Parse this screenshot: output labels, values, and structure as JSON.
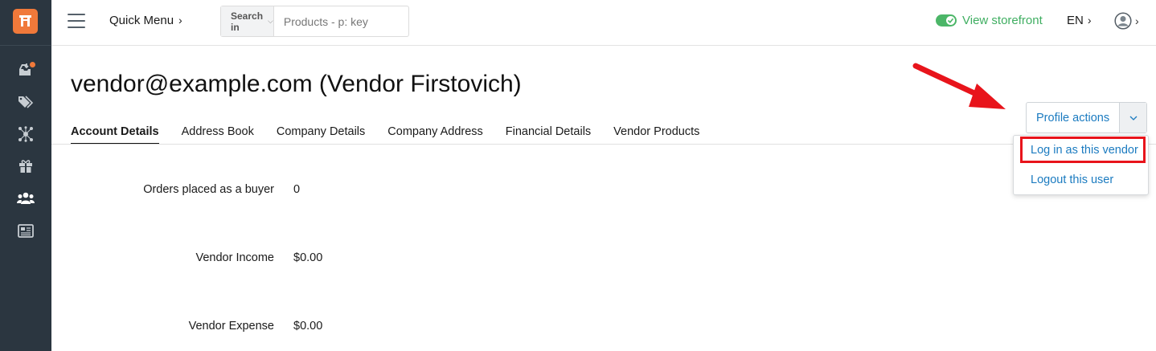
{
  "topbar": {
    "quick_menu": "Quick Menu",
    "search_in_label": "Search in",
    "search_placeholder": "Products - p: key",
    "storefront_label": "View storefront",
    "language": "EN",
    "chevron": "›",
    "small_chevron": "⌄"
  },
  "sidebar": {
    "items": [
      {
        "icon": "inbox-icon",
        "has_notification": true
      },
      {
        "icon": "tags-icon"
      },
      {
        "icon": "network-icon"
      },
      {
        "icon": "gift-icon"
      },
      {
        "icon": "users-icon",
        "active": true
      },
      {
        "icon": "newspaper-icon"
      }
    ]
  },
  "page": {
    "title": "vendor@example.com (Vendor Firstovich)",
    "tabs": [
      {
        "label": "Account Details",
        "active": true
      },
      {
        "label": "Address Book"
      },
      {
        "label": "Company Details"
      },
      {
        "label": "Company Address"
      },
      {
        "label": "Financial Details"
      },
      {
        "label": "Vendor Products"
      }
    ],
    "profile_actions": {
      "label": "Profile actions",
      "items": [
        {
          "label": "Log in as this vendor",
          "highlighted": true
        },
        {
          "label": "Logout this user"
        }
      ]
    },
    "fields": [
      {
        "label": "Orders placed as a buyer",
        "value": "0"
      },
      {
        "label": "Vendor Income",
        "value": "$0.00"
      },
      {
        "label": "Vendor Expense",
        "value": "$0.00"
      }
    ]
  },
  "colors": {
    "sidebar_bg": "#2b3640",
    "accent_orange": "#f0793a",
    "link_blue": "#1b7bc0",
    "storefront_green": "#3fae61",
    "annotation_red": "#e8141b"
  }
}
